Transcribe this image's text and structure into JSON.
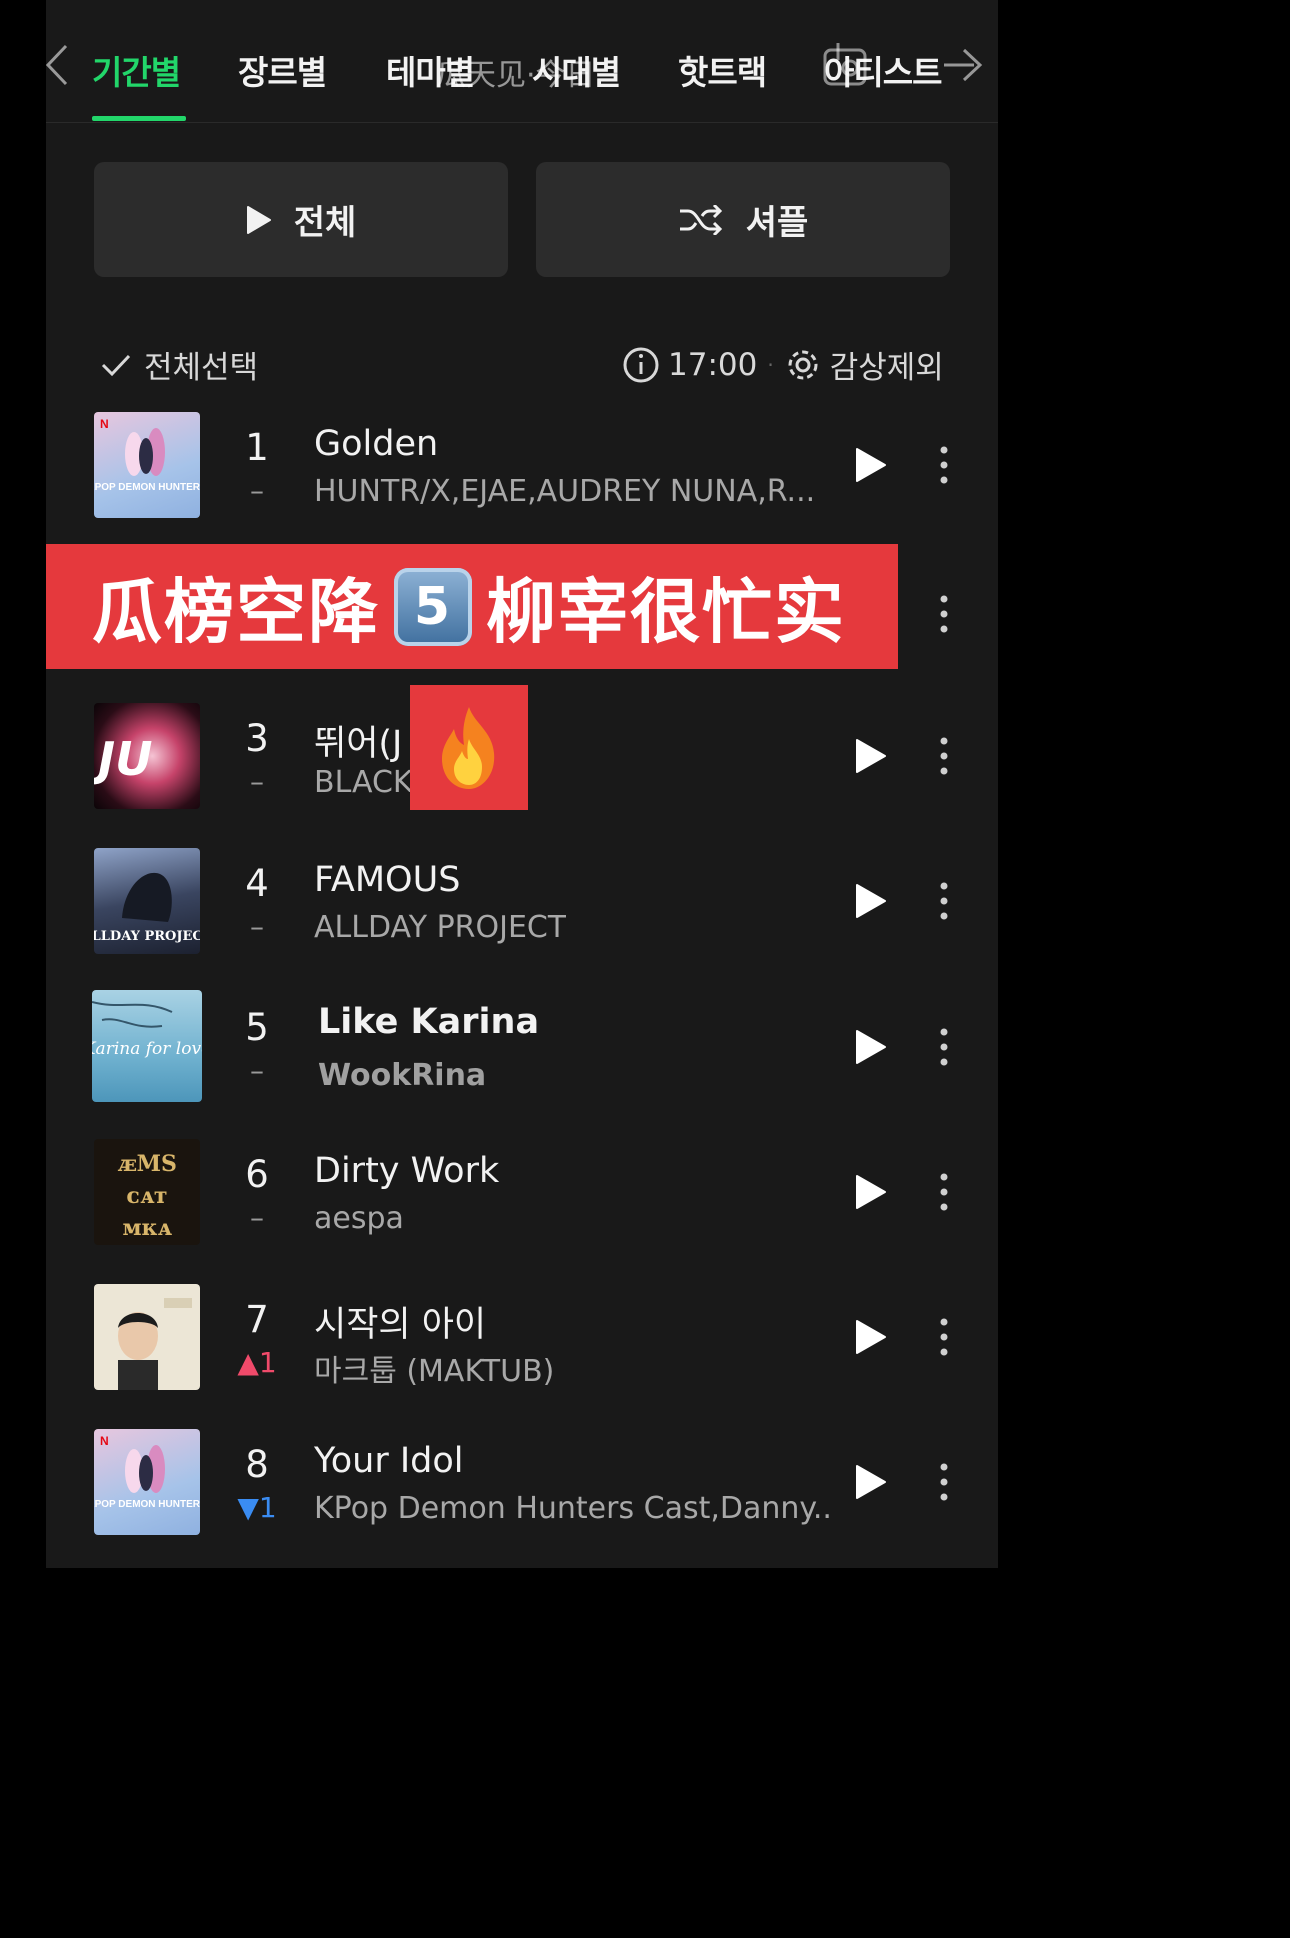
{
  "tabs": [
    {
      "label": "기간별",
      "active": true
    },
    {
      "label": "장르별",
      "active": false
    },
    {
      "label": "테마별",
      "active": false
    },
    {
      "label": "시대별",
      "active": false
    },
    {
      "label": "핫트랙",
      "active": false
    },
    {
      "label": "아티스트",
      "active": false
    }
  ],
  "watermark": "瓜天见·今日",
  "buttons": {
    "play_all": "전체",
    "shuffle": "셔플"
  },
  "select_all": "전체선택",
  "update_time": "17:00",
  "exclude_label": "감상제외",
  "banner": {
    "text_before": "瓜榜空降",
    "number": "5",
    "text_after": "柳宰很忙实"
  },
  "fire_emoji": "🔥",
  "songs": [
    {
      "rank": "1",
      "change": "–",
      "title": "Golden",
      "artist": "HUNTR/X,EJAE,AUDREY NUNA,R..."
    },
    {
      "rank": "3",
      "change": "–",
      "title": "뛰어(J",
      "artist": "BLACK"
    },
    {
      "rank": "4",
      "change": "–",
      "title": "FAMOUS",
      "artist": "ALLDAY PROJECT"
    },
    {
      "rank": "5",
      "change": "–",
      "title": "Like Karina",
      "artist": "WookRina"
    },
    {
      "rank": "6",
      "change": "–",
      "title": "Dirty Work",
      "artist": "aespa"
    },
    {
      "rank": "7",
      "change": "▲1",
      "title": "시작의 아이",
      "artist": "마크툽 (MAKTUB)"
    },
    {
      "rank": "8",
      "change": "▼1",
      "title": "Your Idol",
      "artist": "KPop Demon Hunters Cast,Danny..."
    }
  ],
  "covers": {
    "golden_text": "KPOP DEMON HUNTERS",
    "jump_text": "JU",
    "famous_text": "ALLDAY PROJECT",
    "karina_text": "Karina for love",
    "dirty_text": "ᴁMS ᴄᴀᴛ ᴍᴋᴀ"
  },
  "colors": {
    "accent": "#22d66a",
    "banner": "#e5393d",
    "rank_up": "#f04a6a",
    "rank_down": "#3a8cf2"
  }
}
